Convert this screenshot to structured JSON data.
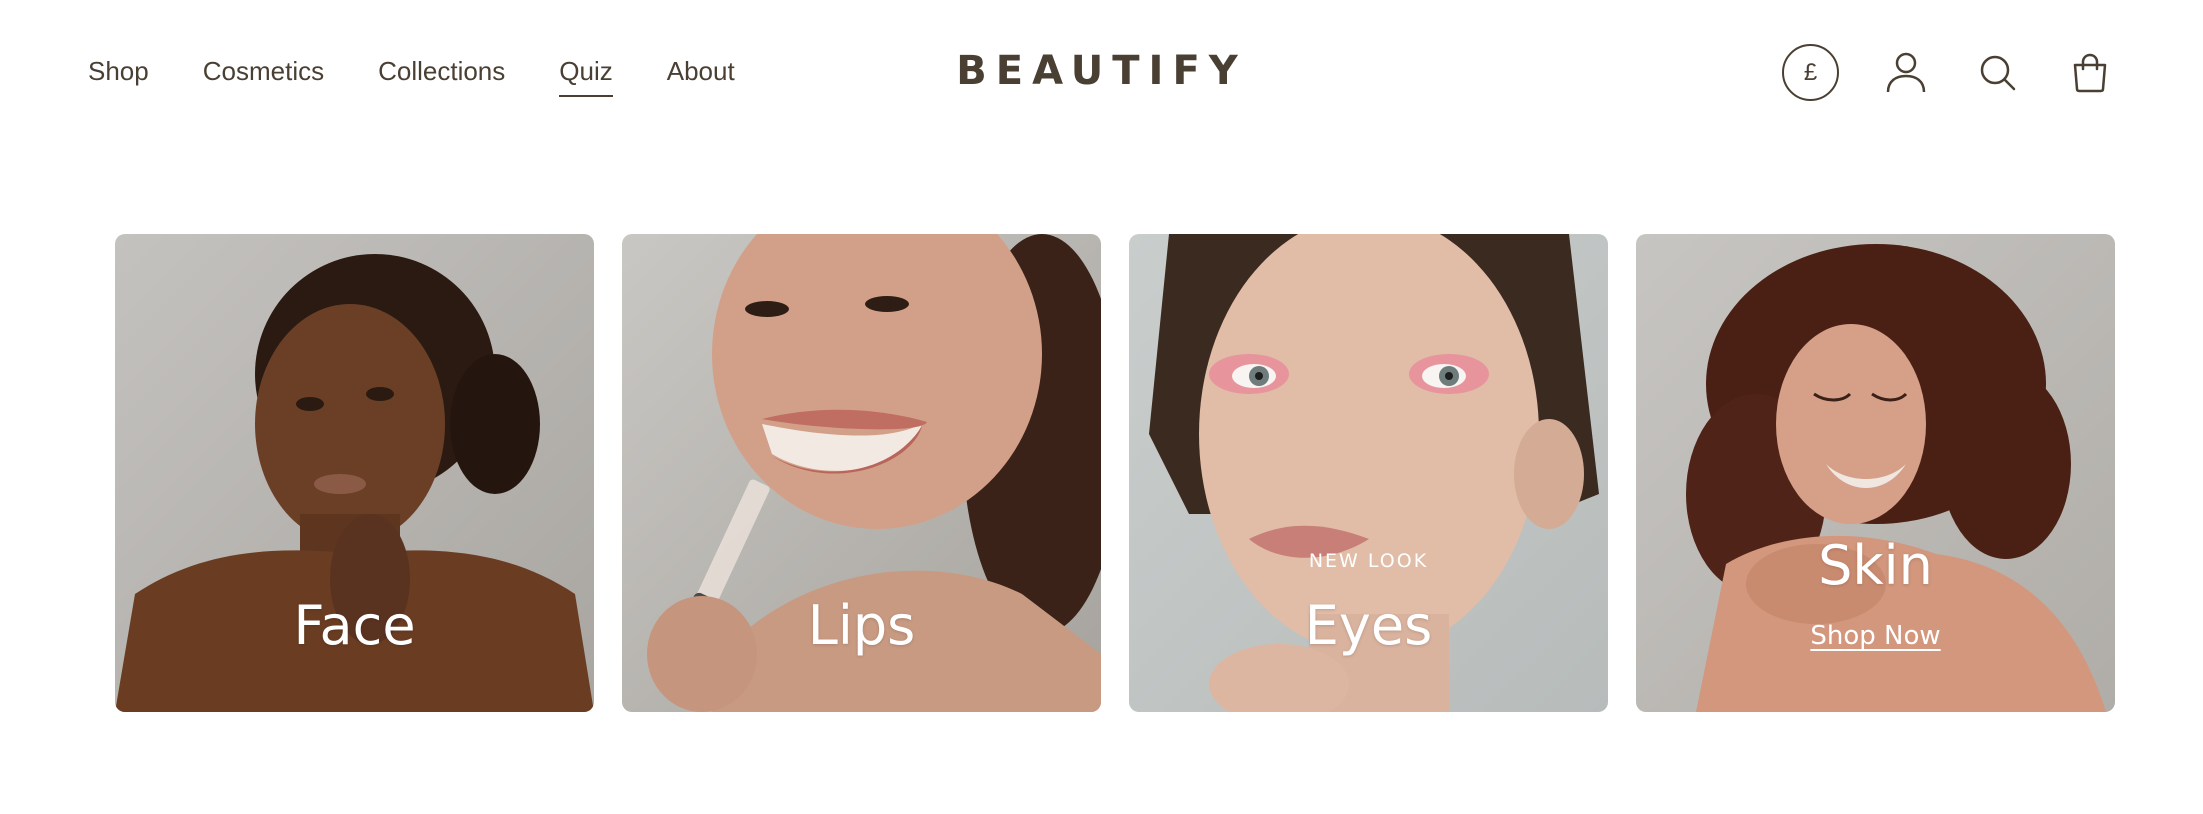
{
  "brand": {
    "logo_text": "BEAUTIFY"
  },
  "nav": {
    "items": [
      {
        "label": "Shop"
      },
      {
        "label": "Cosmetics"
      },
      {
        "label": "Collections"
      },
      {
        "label": "Quiz",
        "active": true
      },
      {
        "label": "About"
      }
    ]
  },
  "actions": {
    "currency_symbol": "£",
    "icons": [
      "currency-icon",
      "account-icon",
      "search-icon",
      "cart-icon"
    ]
  },
  "cards": [
    {
      "title": "Face"
    },
    {
      "title": "Lips"
    },
    {
      "eyebrow": "NEW LOOK",
      "title": "Eyes"
    },
    {
      "title": "Skin",
      "cta": "Shop Now"
    }
  ],
  "colors": {
    "text": "#4a3f33",
    "background": "#ffffff",
    "card_text": "#ffffff"
  }
}
